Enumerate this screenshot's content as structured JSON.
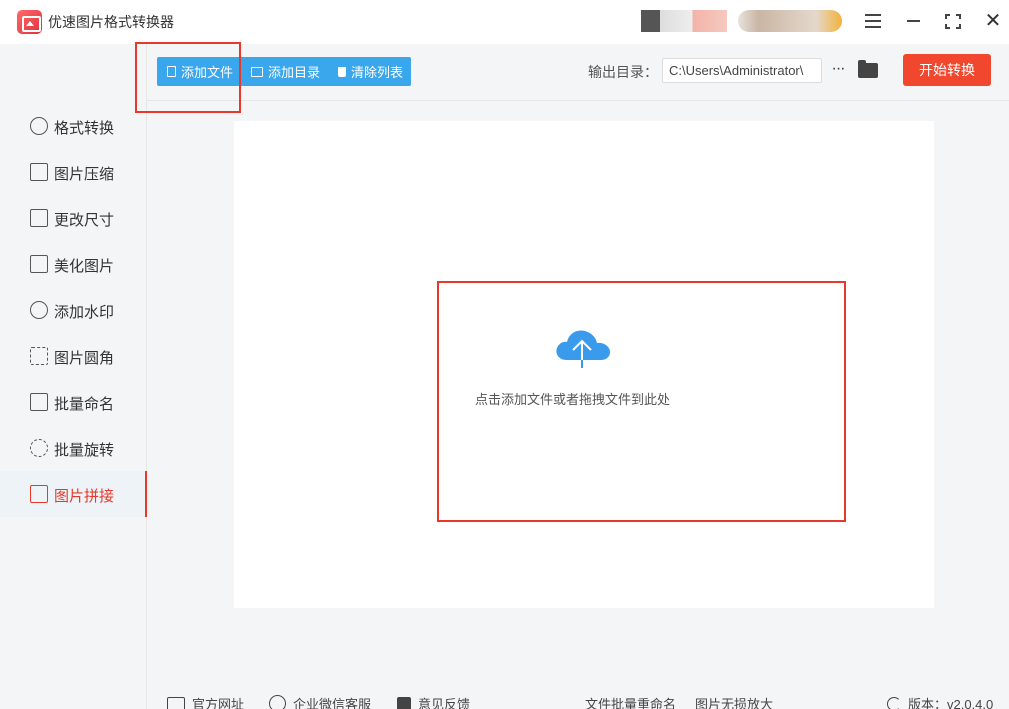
{
  "app": {
    "title": "优速图片格式转换器"
  },
  "sidebar": {
    "items": [
      {
        "label": "格式转换",
        "icon": "format-convert-icon"
      },
      {
        "label": "图片压缩",
        "icon": "compress-icon"
      },
      {
        "label": "更改尺寸",
        "icon": "resize-icon"
      },
      {
        "label": "美化图片",
        "icon": "beautify-icon"
      },
      {
        "label": "添加水印",
        "icon": "watermark-icon"
      },
      {
        "label": "图片圆角",
        "icon": "rounded-corner-icon"
      },
      {
        "label": "批量命名",
        "icon": "rename-icon"
      },
      {
        "label": "批量旋转",
        "icon": "rotate-icon"
      },
      {
        "label": "图片拼接",
        "icon": "stitch-icon",
        "active": true
      }
    ]
  },
  "toolbar": {
    "add_file": "添加文件",
    "add_folder": "添加目录",
    "clear_list": "清除列表",
    "output_label": "输出目录：",
    "output_path": "C:\\Users\\Administrator\\",
    "more": "···",
    "start": "开始转换"
  },
  "dropzone": {
    "hint": "点击添加文件或者拖拽文件到此处"
  },
  "footer": {
    "website": "官方网址",
    "wechat": "企业微信客服",
    "feedback": "意见反馈",
    "batch_rename": "文件批量重命名",
    "upscale": "图片无损放大",
    "version": "版本：v2.0.4.0"
  },
  "colors": {
    "accent_blue": "#3aa6ec",
    "accent_red": "#f0472e",
    "highlight": "#e8382b"
  }
}
